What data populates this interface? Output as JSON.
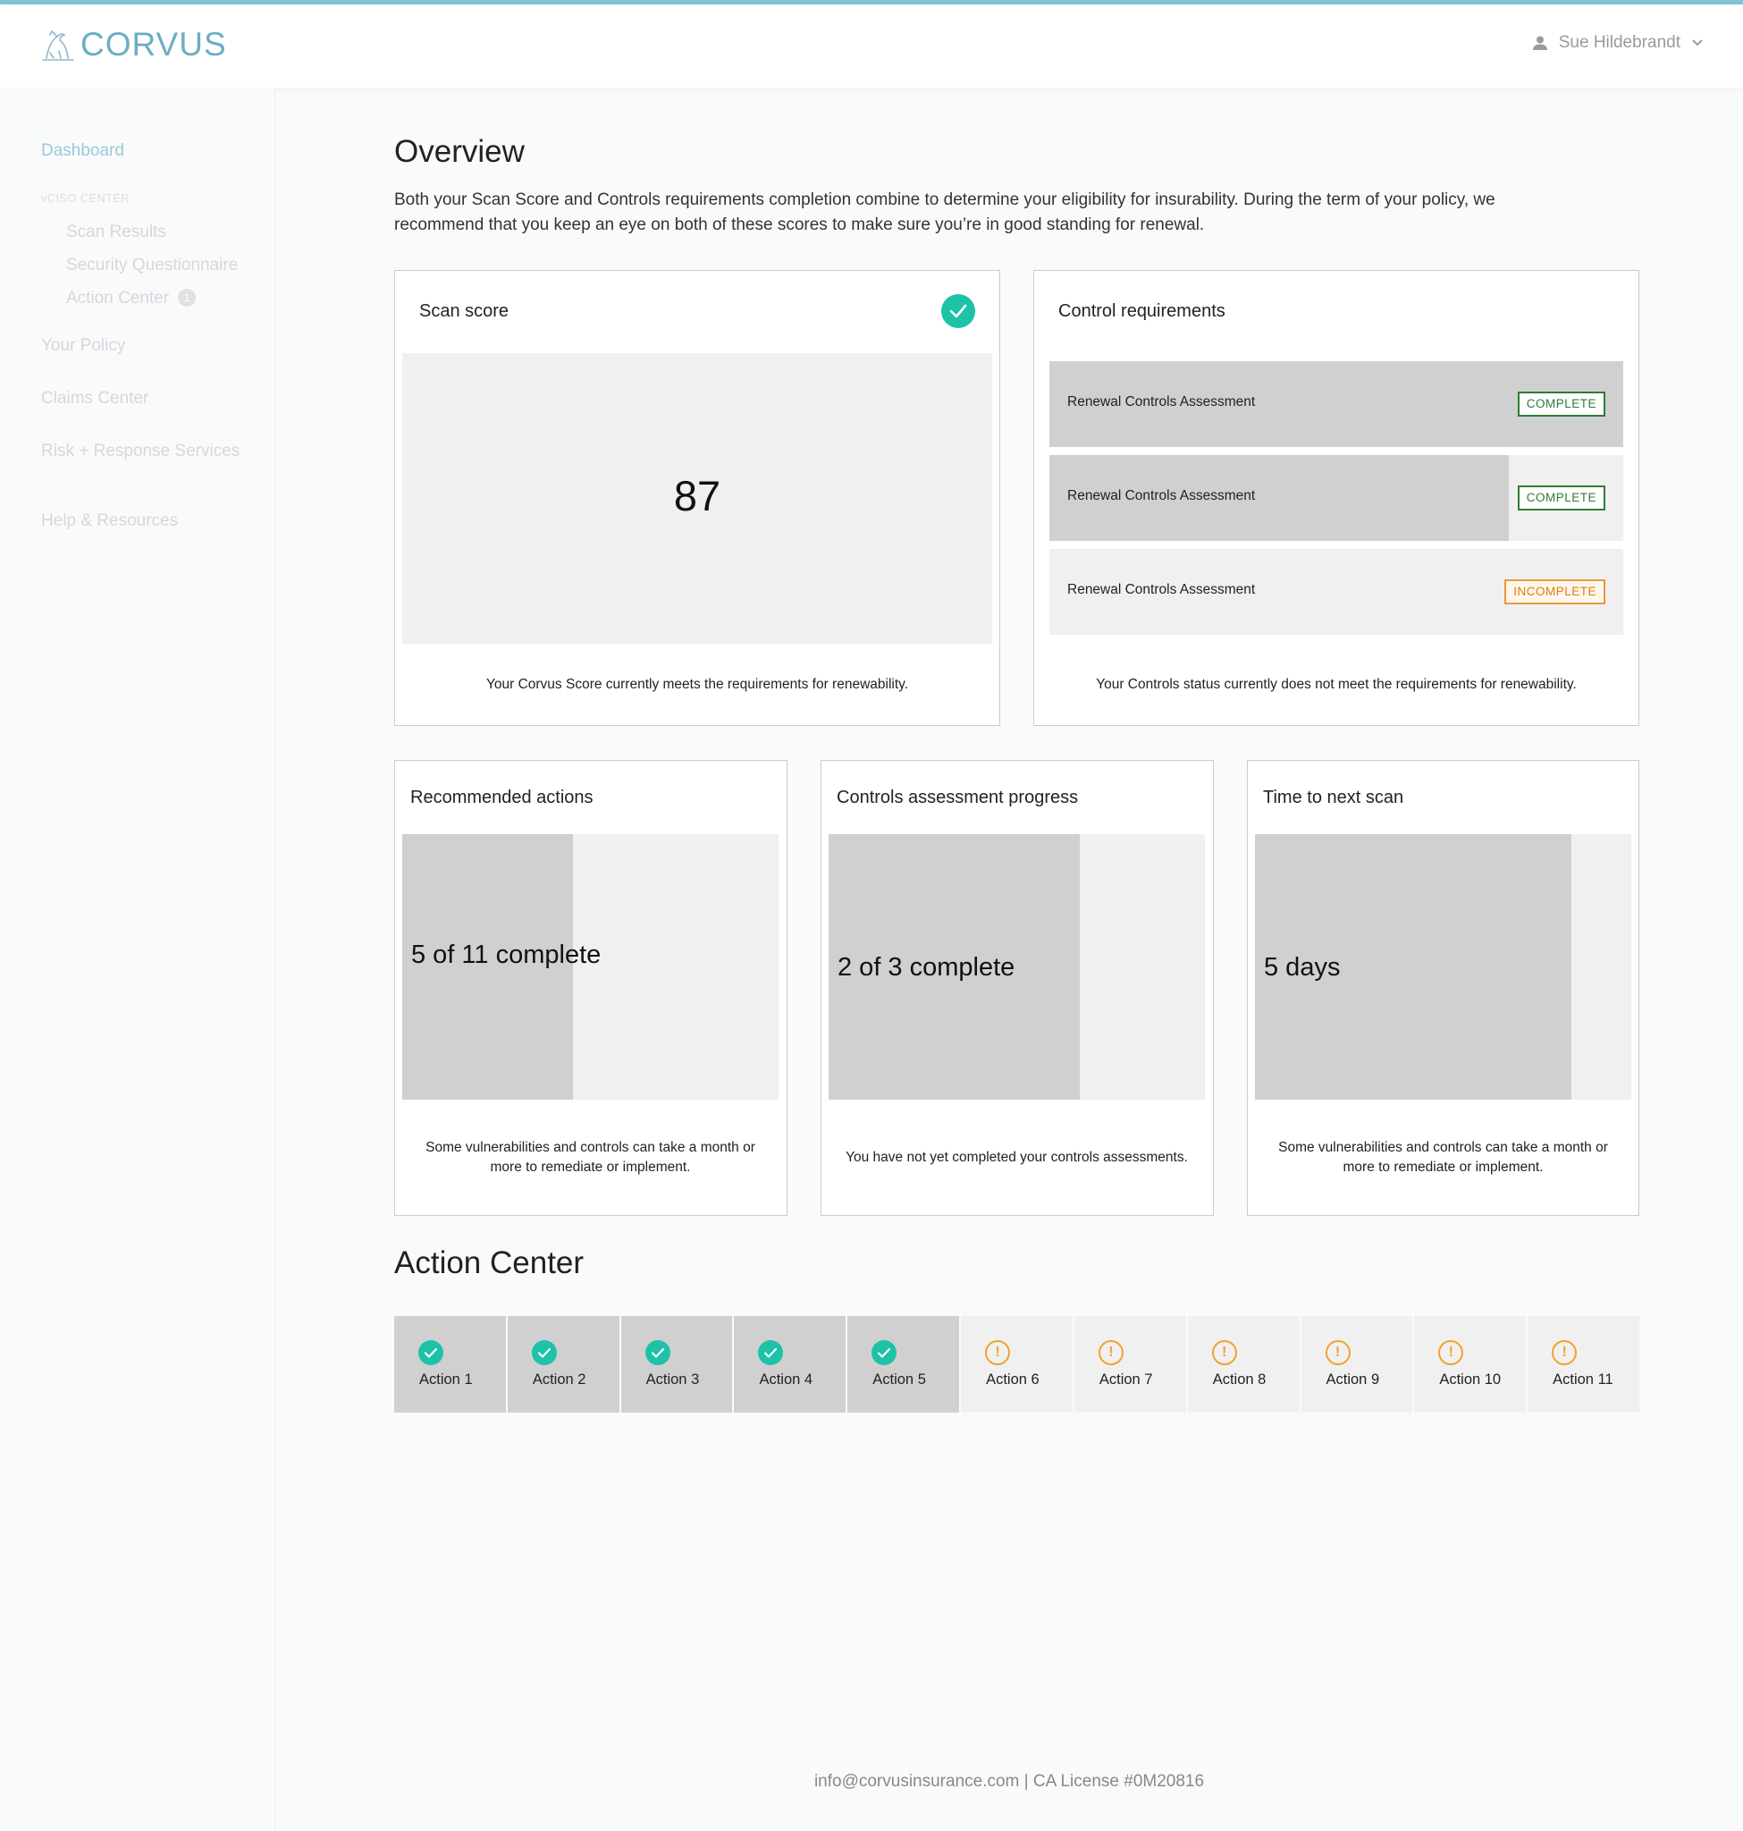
{
  "brand": {
    "name": "CORVUS",
    "accent": "#7fc4d6",
    "check_color": "#1dc2a7",
    "warn_color": "#f0a22e"
  },
  "header": {
    "user_name": "Sue Hildebrandt"
  },
  "sidebar": {
    "dashboard": "Dashboard",
    "section": "vCISO CENTER",
    "scan_results": "Scan Results",
    "security_questionnaire": "Security Questionnaire",
    "action_center": "Action Center",
    "action_center_badge": "1",
    "your_policy": "Your Policy",
    "claims_center": "Claims Center",
    "risk_response": "Risk + Response Services",
    "help": "Help & Resources"
  },
  "overview": {
    "title": "Overview",
    "intro": "Both your Scan Score and Controls requirements completion combine to determine your eligibility for insurability. During the term of your policy, we recommend that you keep an eye on both of these scores to make sure you’re in good standing for renewal."
  },
  "scan_score": {
    "title": "Scan score",
    "value": "87",
    "footer": "Your Corvus Score currently meets the requirements for renewability."
  },
  "control_requirements": {
    "title": "Control requirements",
    "rows": [
      {
        "label": "Renewal Controls Assessment",
        "status": "COMPLETE",
        "progress": 1.0
      },
      {
        "label": "Renewal Controls Assessment",
        "status": "COMPLETE",
        "progress": 0.8
      },
      {
        "label": "Renewal Controls Assessment",
        "status": "INCOMPLETE",
        "progress": 0
      }
    ],
    "footer": "Your Controls status currently does not meet the requirements for renewability."
  },
  "recommended_actions": {
    "title": "Recommended actions",
    "value": "5 of 11 complete",
    "progress": 0.4545,
    "footer": "Some vulnerabilities and controls can take a month or more to remediate or implement."
  },
  "controls_progress": {
    "title": "Controls assessment progress",
    "value": "2 of 3 complete",
    "progress": 0.6667,
    "footer": "You have not yet completed your controls assessments."
  },
  "next_scan": {
    "title": "Time to next scan",
    "value": "5 days",
    "progress": 0.84,
    "footer": "Some vulnerabilities and controls can take a month or more to remediate or implement."
  },
  "action_center": {
    "title": "Action Center",
    "actions": [
      {
        "label": "Action 1",
        "done": true
      },
      {
        "label": "Action 2",
        "done": true
      },
      {
        "label": "Action 3",
        "done": true
      },
      {
        "label": "Action 4",
        "done": true
      },
      {
        "label": "Action 5",
        "done": true
      },
      {
        "label": "Action 6",
        "done": false
      },
      {
        "label": "Action 7",
        "done": false
      },
      {
        "label": "Action 8",
        "done": false
      },
      {
        "label": "Action 9",
        "done": false
      },
      {
        "label": "Action 10",
        "done": false
      },
      {
        "label": "Action 11",
        "done": false
      }
    ]
  },
  "footer": {
    "text": "info@corvusinsurance.com | CA License #0M20816"
  }
}
